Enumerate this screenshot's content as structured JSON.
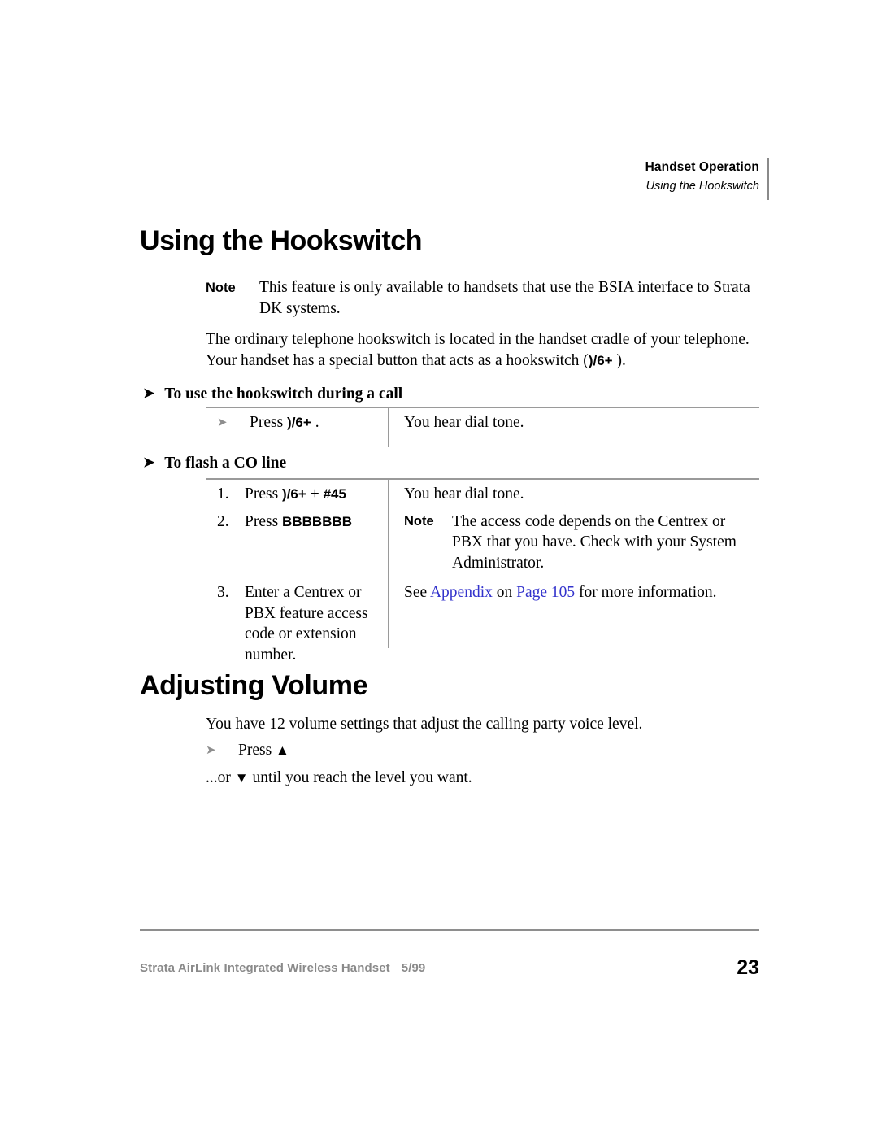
{
  "running_header": {
    "title": "Handset Operation",
    "subtitle": "Using the Hookswitch"
  },
  "sections": {
    "hookswitch": {
      "heading": "Using the Hookswitch",
      "note": {
        "label": "Note",
        "text": "This feature is only available to handsets that use the BSIA interface to Strata DK systems."
      },
      "intro_paragraph": {
        "before": "The ordinary telephone hookswitch is located in the handset cradle of your telephone. Your handset has a special button that acts as a hookswitch (",
        "key": ")/6+",
        "after": "  )."
      },
      "procedure_1": {
        "heading": "To use the hookswitch during a call",
        "rows": [
          {
            "marker": "➤",
            "action_before": "Press ",
            "action_key": ")/6+",
            "action_after": "  .",
            "result": "You hear dial tone."
          }
        ]
      },
      "procedure_2": {
        "heading": "To flash a CO line",
        "rows": [
          {
            "marker": "1.",
            "action_before": "Press ",
            "action_key": ")/6+",
            "action_mid": "   + ",
            "action_key2": "#45",
            "result": "You hear dial tone."
          },
          {
            "marker": "2.",
            "action_before": "Press ",
            "action_key": "BBBBBBB",
            "result_note_label": "Note",
            "result_note_text": "The access code depends on the Centrex or PBX that you have. Check with your System Administrator."
          },
          {
            "marker": "3.",
            "action_before": "Enter a Centrex or PBX feature access code or extension number.",
            "result_before": "See ",
            "result_link_1": "Appendix",
            "result_mid": " on ",
            "result_link_2": "Page 105",
            "result_after": " for more information."
          }
        ]
      }
    },
    "volume": {
      "heading": "Adjusting Volume",
      "paragraph": "You have 12 volume settings that adjust the calling party voice level.",
      "bullet": {
        "marker": "➤",
        "text": "Press ",
        "key_glyph": "▲"
      },
      "followup": {
        "before": "...or ",
        "key_glyph": "▼",
        "after": " until you reach the level you want."
      }
    }
  },
  "footer": {
    "document_title": "Strata AirLink Integrated Wireless Handset",
    "date": "5/99",
    "page_number": "23"
  },
  "colors": {
    "link": "#3333cc",
    "rule": "#9a9a9a",
    "footer_text": "#8a8a8a"
  }
}
